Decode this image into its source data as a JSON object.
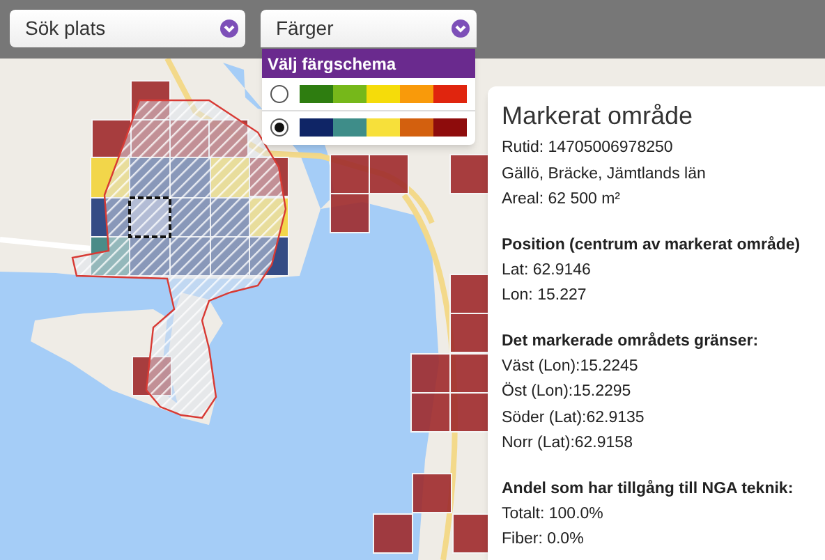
{
  "search_dropdown": {
    "label": "Sök plats"
  },
  "color_dropdown": {
    "label": "Färger",
    "expanded": true
  },
  "color_menu": {
    "title": "Välj färgschema",
    "schemes": [
      {
        "selected": false,
        "swatches": [
          {
            "color": "#2e7d10"
          },
          {
            "color": "#76b81a"
          },
          {
            "color": "#f5dc0a"
          },
          {
            "color": "#f99a0a"
          },
          {
            "color": "#e0250e"
          }
        ]
      },
      {
        "selected": true,
        "swatches": [
          {
            "color": "#0f2566"
          },
          {
            "color": "#3e8d89"
          },
          {
            "color": "#f7e03a"
          },
          {
            "color": "#d3600e"
          },
          {
            "color": "#8e0c0c"
          }
        ]
      }
    ]
  },
  "info_panel": {
    "title": "Markerat område",
    "sections": [
      {
        "lines": [
          "Rutid: 14705006978250",
          "Gällö, Bräcke, Jämtlands län",
          "Areal: 62 500 m²"
        ]
      },
      {
        "heading": "Position (centrum av markerat område)",
        "lines": [
          "Lat: 62.9146",
          "Lon: 15.227"
        ]
      },
      {
        "heading": "Det markerade områdets gränser:",
        "lines": [
          "Väst (Lon):15.2245",
          "Öst (Lon):15.2295",
          "Söder (Lat):62.9135",
          "Norr (Lat):62.9158"
        ]
      },
      {
        "heading": "Andel som har tillgång till NGA teknik:",
        "lines": [
          "Totalt: 100.0%",
          "Fiber: 0.0%"
        ]
      }
    ]
  }
}
